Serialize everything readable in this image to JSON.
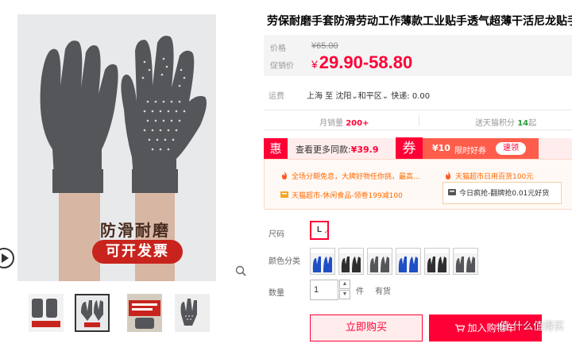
{
  "product": {
    "title": "劳保耐磨手套防滑劳动工作薄款工业贴手透气超薄干活尼龙贴手加厚"
  },
  "image": {
    "promo_text": "防滑耐磨",
    "promo_pill": "可开发票"
  },
  "price": {
    "orig_label": "价格",
    "orig_value": "¥65.00",
    "sale_label": "促销价",
    "currency": "¥",
    "sale_value": "29.90-58.80"
  },
  "shipping": {
    "label": "运费",
    "text": "上海  至 沈阳⌄和平区⌄ 快递: 0.00"
  },
  "stats": {
    "monthly_label": "月销量 ",
    "monthly_value": "200+",
    "points_label": "送天猫积分 ",
    "points_value": "14",
    "points_suffix": "起"
  },
  "coupon": {
    "hui": "惠",
    "more_text": "查看更多同款:",
    "more_price": "¥39.9",
    "quan": "券",
    "amount": "¥10",
    "limit": "限时好券",
    "get": "速领"
  },
  "promos": {
    "p1": "全场分期免息，大牌好物任你挑，最高...",
    "p2": "天猫超市日用百货100元",
    "p3": "天猫超市-休闲食品-领卷199减100",
    "p4": "今日疯抢-翻牌抢0.01元好货"
  },
  "options": {
    "size_label": "尺码",
    "size_value": "L",
    "color_label": "颜色分类",
    "qty_label": "数量",
    "qty_value": "1",
    "unit": "件",
    "stock": "有货"
  },
  "actions": {
    "buy": "立即购买",
    "cart": "加入购物车"
  },
  "watermark": "值 什么值得买",
  "colors": {
    "accent": "#ff0036",
    "glove_gray": "#55565a",
    "swatch_blue": "#1f4fc4",
    "swatch_black": "#2f2f31"
  }
}
